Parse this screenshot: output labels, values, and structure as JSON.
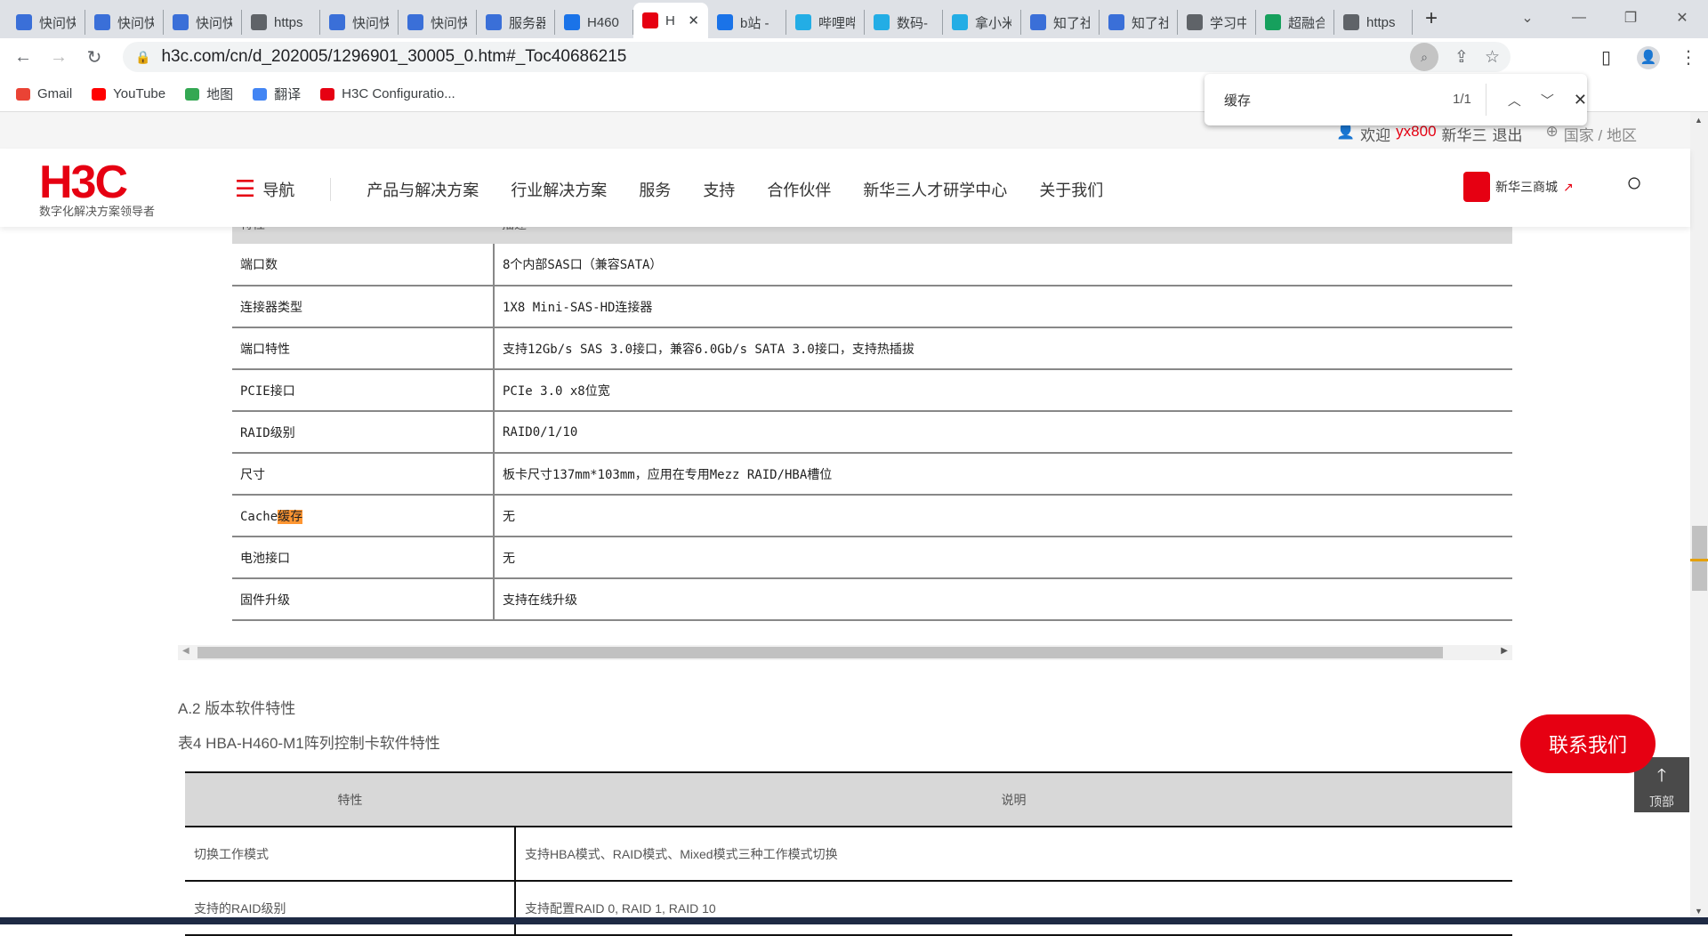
{
  "browser": {
    "tabs": [
      {
        "label": "快问快",
        "icon": "kuaiwen-icon",
        "color": "#3a6fd8"
      },
      {
        "label": "快问快",
        "icon": "kuaiwen-icon",
        "color": "#3a6fd8"
      },
      {
        "label": "快问快",
        "icon": "kuaiwen-icon",
        "color": "#3a6fd8"
      },
      {
        "label": "https",
        "icon": "globe-icon",
        "color": "#5f6368"
      },
      {
        "label": "快问快",
        "icon": "kuaiwen-icon",
        "color": "#3a6fd8"
      },
      {
        "label": "快问快",
        "icon": "kuaiwen-icon",
        "color": "#3a6fd8"
      },
      {
        "label": "服务器",
        "icon": "kuaiwen-icon",
        "color": "#3a6fd8"
      },
      {
        "label": "H460",
        "icon": "search-icon",
        "color": "#1a73e8"
      },
      {
        "label": "H",
        "icon": "h3c-icon",
        "color": "#e60012",
        "active": true
      },
      {
        "label": "b站 -",
        "icon": "search-icon",
        "color": "#1a73e8"
      },
      {
        "label": "哔哩哔",
        "icon": "bilibili-icon",
        "color": "#23ade5"
      },
      {
        "label": "数码-",
        "icon": "bilibili-icon",
        "color": "#23ade5"
      },
      {
        "label": "拿小米",
        "icon": "bilibili-icon",
        "color": "#23ade5"
      },
      {
        "label": "知了社",
        "icon": "kuaiwen-icon",
        "color": "#3a6fd8"
      },
      {
        "label": "知了社",
        "icon": "kuaiwen-icon",
        "color": "#3a6fd8"
      },
      {
        "label": "学习中",
        "icon": "globe-icon",
        "color": "#5f6368"
      },
      {
        "label": "超融合",
        "icon": "uis-icon",
        "color": "#16a05d"
      },
      {
        "label": "https",
        "icon": "globe-icon",
        "color": "#5f6368"
      }
    ],
    "url": "h3c.com/cn/d_202005/1296901_30005_0.htm#_Toc40686215",
    "bookmarks": [
      {
        "label": "Gmail",
        "color": "#ea4335"
      },
      {
        "label": "YouTube",
        "color": "#ff0000"
      },
      {
        "label": "地图",
        "color": "#34a853"
      },
      {
        "label": "翻译",
        "color": "#4285f4"
      },
      {
        "label": "H3C Configuratio...",
        "color": "#e60012"
      }
    ],
    "find": {
      "query": "缓存",
      "count": "1/1"
    }
  },
  "topbar": {
    "welcome": "欢迎",
    "user": "yx800",
    "company": "新华三",
    "logout": "退出",
    "region": "国家 / 地区"
  },
  "header": {
    "logo": "H3C",
    "slogan": "数字化解决方案领导者",
    "nav_label": "导航",
    "menu": [
      "产品与解决方案",
      "行业解决方案",
      "服务",
      "支持",
      "合作伙伴",
      "新华三人才研学中心",
      "关于我们"
    ],
    "shop": "新华三商城",
    "brand_color": "#e60012"
  },
  "table1": {
    "header": [
      "特性",
      "描述"
    ],
    "rows": [
      [
        "端口数",
        "8个内部SAS口（兼容SATA）"
      ],
      [
        "连接器类型",
        "1X8 Mini-SAS-HD连接器"
      ],
      [
        "端口特性",
        "支持12Gb/s SAS 3.0接口，兼容6.0Gb/s SATA 3.0接口，支持热插拔"
      ],
      [
        "PCIE接口",
        "PCIe 3.0 x8位宽"
      ],
      [
        "RAID级别",
        "RAID0/1/10"
      ],
      [
        "尺寸",
        "板卡尺寸137mm*103mm，应用在专用Mezz RAID/HBA槽位"
      ],
      [
        "Cache",
        "无"
      ],
      [
        "电池接口",
        "无"
      ],
      [
        "固件升级",
        "支持在线升级"
      ]
    ],
    "highlight": "缓存"
  },
  "section": {
    "heading": "A.2 版本软件特性",
    "caption": "表4 HBA-H460-M1阵列控制卡软件特性"
  },
  "table2": {
    "header": [
      "特性",
      "说明"
    ],
    "rows": [
      [
        "切换工作模式",
        "支持HBA模式、RAID模式、Mixed模式三种工作模式切换"
      ],
      [
        "支持的RAID级别",
        "支持配置RAID 0, RAID 1, RAID 10"
      ]
    ]
  },
  "floating": {
    "contact": "联系我们",
    "top": "顶部"
  }
}
